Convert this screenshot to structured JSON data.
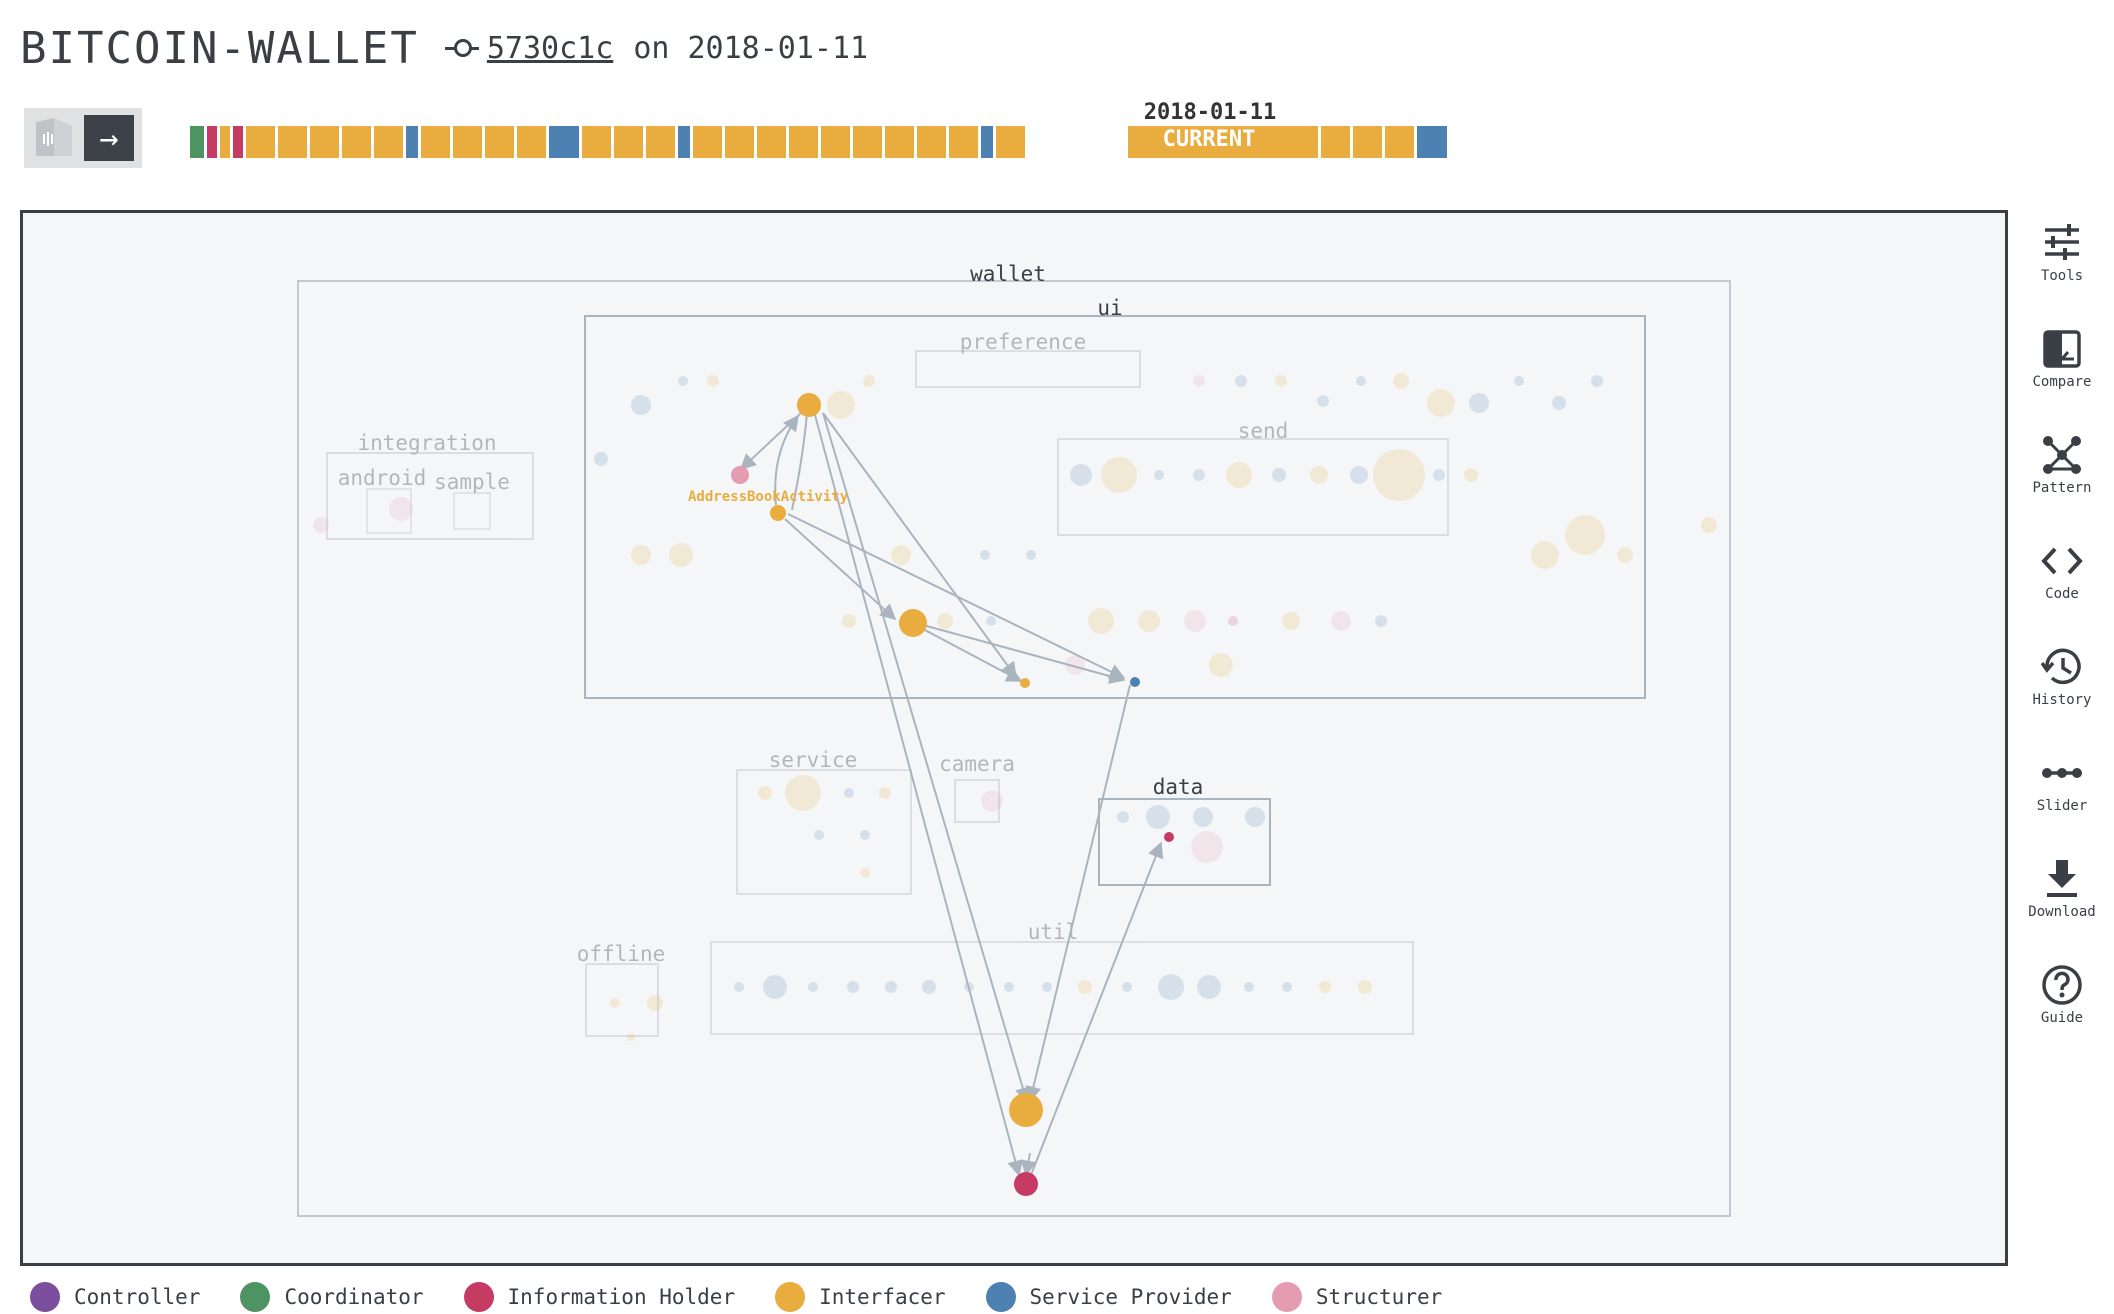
{
  "header": {
    "title": "BITCOIN-WALLET",
    "commit_hash": "5730c1c",
    "commit_date_text": "on 2018-01-11"
  },
  "timeline": {
    "selected_date": "2018-01-11",
    "current_label": "CURRENT",
    "segments": [
      "coordinator",
      "information-holder",
      "interfacer",
      "information-holder",
      "interfacer",
      "interfacer",
      "interfacer",
      "interfacer",
      "interfacer",
      "service-provider",
      "interfacer",
      "interfacer",
      "interfacer",
      "interfacer",
      "service-provider",
      "interfacer",
      "interfacer",
      "interfacer",
      "service-provider",
      "interfacer",
      "interfacer",
      "interfacer",
      "interfacer",
      "interfacer",
      "interfacer",
      "interfacer",
      "interfacer",
      "interfacer",
      "service-provider",
      "interfacer",
      "current",
      "interfacer",
      "interfacer",
      "interfacer",
      "interfacer",
      "interfacer",
      "interfacer",
      "interfacer",
      "service-provider"
    ]
  },
  "packages": {
    "wallet": "wallet",
    "ui": "ui",
    "preference": "preference",
    "send": "send",
    "integration": "integration",
    "android": "android",
    "sample": "sample",
    "service": "service",
    "camera": "camera",
    "data": "data",
    "offline": "offline",
    "util": "util"
  },
  "highlight_label": "AddressBookActivity",
  "tools": [
    {
      "label": "Tools",
      "icon": "sliders-icon"
    },
    {
      "label": "Compare",
      "icon": "compare-icon"
    },
    {
      "label": "Pattern",
      "icon": "pattern-icon"
    },
    {
      "label": "Code",
      "icon": "code-icon"
    },
    {
      "label": "History",
      "icon": "history-icon"
    },
    {
      "label": "Slider",
      "icon": "slider-icon"
    },
    {
      "label": "Download",
      "icon": "download-icon"
    },
    {
      "label": "Guide",
      "icon": "help-icon"
    }
  ],
  "legend": [
    {
      "label": "Controller",
      "color": "#7b4f9e"
    },
    {
      "label": "Coordinator",
      "color": "#4e9463"
    },
    {
      "label": "Information Holder",
      "color": "#c63b64"
    },
    {
      "label": "Interfacer",
      "color": "#e9ad3f"
    },
    {
      "label": "Service Provider",
      "color": "#4d81b1"
    },
    {
      "label": "Structurer",
      "color": "#e59cb0"
    }
  ],
  "colors": {
    "controller": "#7b4f9e",
    "coordinator": "#4e9463",
    "information-holder": "#c63b64",
    "interfacer": "#e9ad3f",
    "service-provider": "#4d81b1",
    "structurer": "#e59cb0",
    "edge": "#aab4be",
    "package-border": "#aab4be"
  }
}
